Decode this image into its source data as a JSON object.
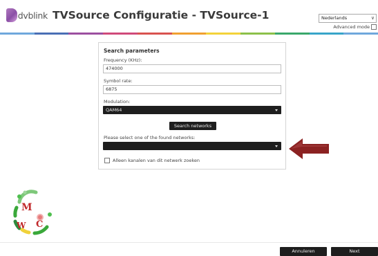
{
  "header": {
    "logo_text": "dvblink",
    "title": "TVSource Configuratie - TVSource-1",
    "language_value": "Nederlands",
    "advanced_mode_label": "Advanced mode"
  },
  "colors": {
    "rainbow": [
      "#6fa8dc",
      "#4a6fb5",
      "#9c4fa0",
      "#d04a7a",
      "#d9534f",
      "#f0a030",
      "#f3d23a",
      "#8cc04a",
      "#3aa86b",
      "#38a5c9",
      "#6fa8dc"
    ],
    "accent_arrow": "#8b2222"
  },
  "panel": {
    "title": "Search parameters",
    "frequency_label": "Frequency (KHz):",
    "frequency_value": "474000",
    "symbol_rate_label": "Symbol rate:",
    "symbol_rate_value": "6875",
    "modulation_label": "Modulation:",
    "modulation_value": "QAM64",
    "search_button_label": "Search networks",
    "networks_label": "Please select one of the found networks:",
    "networks_value": "",
    "checkbox_label": "Alleen kanalen van dit netwerk zoeken",
    "checkbox_checked": false
  },
  "watermark": {
    "letters": [
      "M",
      "W",
      "C"
    ]
  },
  "footer": {
    "cancel_label": "Annuleren",
    "next_label": "Next"
  }
}
